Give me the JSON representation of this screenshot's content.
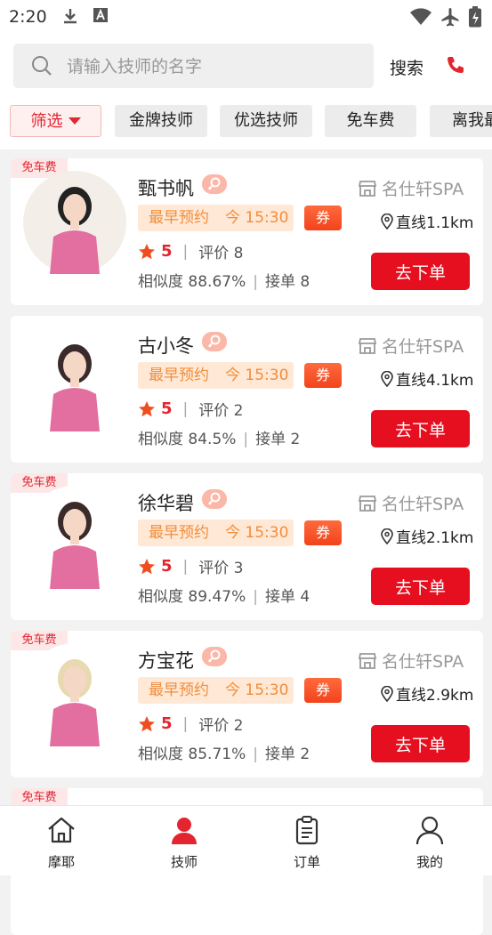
{
  "status_bar": {
    "time": "2:20"
  },
  "search": {
    "placeholder": "请输入技师的名字",
    "button": "搜索"
  },
  "filters": [
    "筛选",
    "金牌技师",
    "优选技师",
    "免车费",
    "离我最"
  ],
  "colors": {
    "accent": "#e50f20",
    "booking_text": "#f08e3c",
    "booking_bg": "#ffe8d6"
  },
  "list": [
    {
      "badge": "免车费",
      "name": "甄书帆",
      "shop": "名仕轩SPA",
      "booking_label": "最早预约",
      "booking_time": "今 15:30",
      "coupon": "券",
      "distance": "直线1.1km",
      "score": "5",
      "reviews": "评价 8",
      "similarity": "相似度 88.67%",
      "orders": "接单 8",
      "button": "去下单"
    },
    {
      "badge": "",
      "name": "古小冬",
      "shop": "名仕轩SPA",
      "booking_label": "最早预约",
      "booking_time": "今 15:30",
      "coupon": "券",
      "distance": "直线4.1km",
      "score": "5",
      "reviews": "评价 2",
      "similarity": "相似度 84.5%",
      "orders": "接单 2",
      "button": "去下单"
    },
    {
      "badge": "免车费",
      "name": "徐华碧",
      "shop": "名仕轩SPA",
      "booking_label": "最早预约",
      "booking_time": "今 15:30",
      "coupon": "券",
      "distance": "直线2.1km",
      "score": "5",
      "reviews": "评价 3",
      "similarity": "相似度 89.47%",
      "orders": "接单 4",
      "button": "去下单"
    },
    {
      "badge": "免车费",
      "name": "方宝花",
      "shop": "名仕轩SPA",
      "booking_label": "最早预约",
      "booking_time": "今 15:30",
      "coupon": "券",
      "distance": "直线2.9km",
      "score": "5",
      "reviews": "评价 2",
      "similarity": "相似度 85.71%",
      "orders": "接单 2",
      "button": "去下单"
    },
    {
      "badge": "免车费"
    }
  ],
  "tabs": [
    {
      "label": "摩耶",
      "icon": "home-icon",
      "active": false
    },
    {
      "label": "技师",
      "icon": "person-icon",
      "active": true
    },
    {
      "label": "订单",
      "icon": "clipboard-icon",
      "active": false
    },
    {
      "label": "我的",
      "icon": "user-icon",
      "active": false
    }
  ]
}
